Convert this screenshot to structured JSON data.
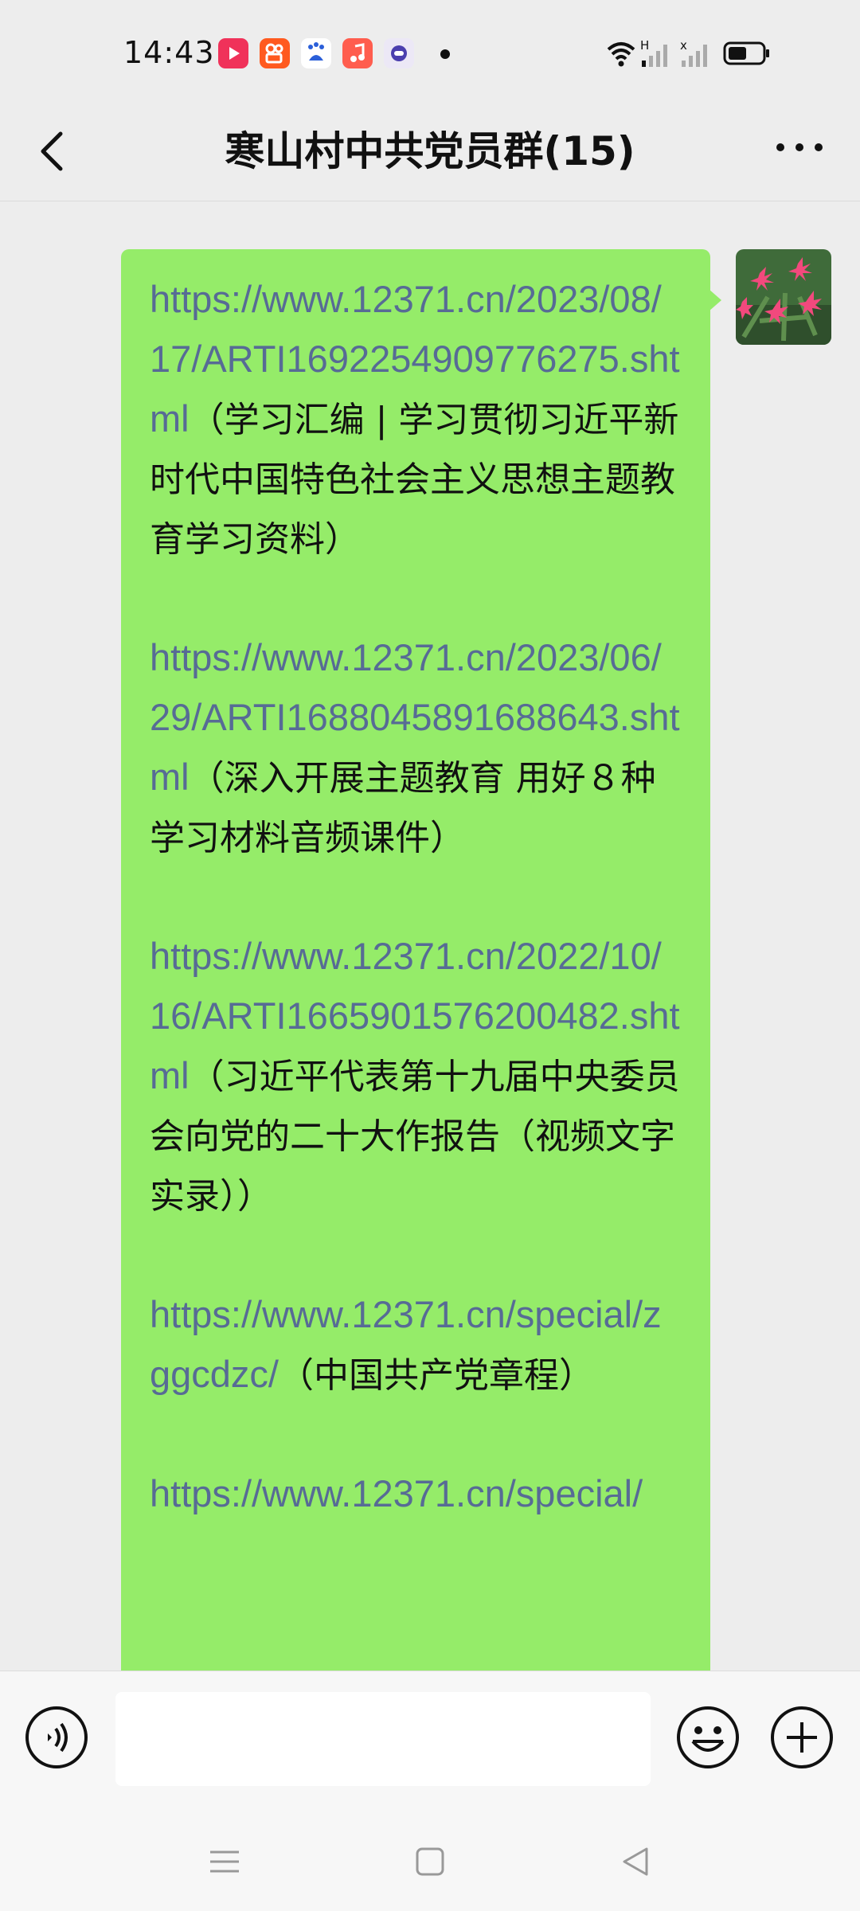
{
  "status_bar": {
    "time": "14:43",
    "apps": [
      "video-app-icon",
      "kuaishou-icon",
      "baidu-icon",
      "music-icon",
      "game-icon"
    ],
    "network_label_1": "H",
    "network_label_2": "x"
  },
  "header": {
    "title": "寒山村中共党员群(15)"
  },
  "message": {
    "entries": [
      {
        "link": "https://www.12371.cn/2023/08/17/ARTI1692254909776275.shtml",
        "desc": "（学习汇编 | 学习贯彻习近平新时代中国特色社会主义思想主题教育学习资料）"
      },
      {
        "link": "https://www.12371.cn/2023/06/29/ARTI1688045891688643.shtml",
        "desc": "（深入开展主题教育 用好８种学习材料音频课件）"
      },
      {
        "link": "https://www.12371.cn/2022/10/16/ARTI1665901576200482.shtml",
        "desc": "（习近平代表第十九届中央委员会向党的二十大作报告（视频文字实录））"
      },
      {
        "link": "https://www.12371.cn/special/zggcdzc/",
        "desc": "（中国共产党章程）"
      },
      {
        "link": "https://www.12371.cn/special/",
        "desc": ""
      }
    ]
  },
  "colors": {
    "bubble": "#95ec69",
    "link": "#576b95",
    "background": "#ededed"
  }
}
